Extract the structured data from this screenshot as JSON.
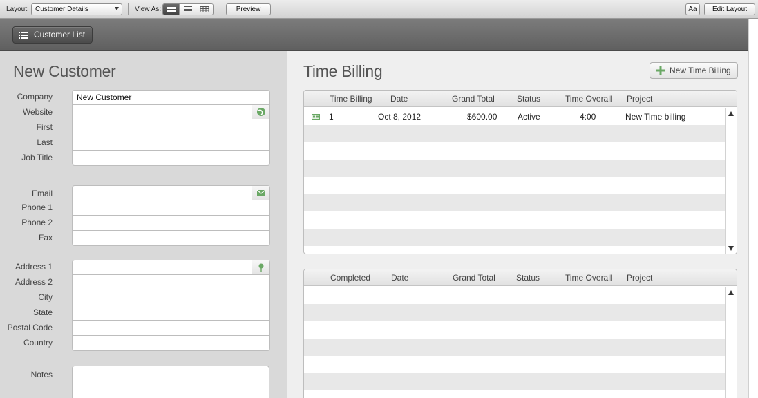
{
  "toolbar": {
    "layout_label": "Layout:",
    "layout_value": "Customer Details",
    "view_as_label": "View As:",
    "preview_label": "Preview",
    "font_button": "Aa",
    "edit_layout_label": "Edit Layout"
  },
  "header": {
    "customer_list_label": "Customer List"
  },
  "customer": {
    "title": "New Customer",
    "fields_group1": [
      {
        "label": "Company",
        "value": "New Customer"
      },
      {
        "label": "Website",
        "value": ""
      },
      {
        "label": "First",
        "value": ""
      },
      {
        "label": "Last",
        "value": ""
      },
      {
        "label": "Job Title",
        "value": ""
      }
    ],
    "fields_group2": [
      {
        "label": "Email",
        "value": ""
      },
      {
        "label": "Phone 1",
        "value": ""
      },
      {
        "label": "Phone 2",
        "value": ""
      },
      {
        "label": "Fax",
        "value": ""
      }
    ],
    "fields_group3": [
      {
        "label": "Address 1",
        "value": ""
      },
      {
        "label": "Address 2",
        "value": ""
      },
      {
        "label": "City",
        "value": ""
      },
      {
        "label": "State",
        "value": ""
      },
      {
        "label": "Postal Code",
        "value": ""
      },
      {
        "label": "Country",
        "value": ""
      }
    ],
    "notes_label": "Notes"
  },
  "time_billing": {
    "title": "Time Billing",
    "new_button": "New Time Billing",
    "columns": [
      "Time Billing",
      "Date",
      "Grand Total",
      "Status",
      "Time Overall",
      "Project"
    ],
    "rows": [
      {
        "id": "1",
        "date": "Oct 8, 2012",
        "grand_total": "$600.00",
        "status": "Active",
        "time_overall": "4:00",
        "project": "New Time billing"
      }
    ]
  },
  "completed": {
    "columns": [
      "Completed",
      "Date",
      "Grand Total",
      "Status",
      "Time Overall",
      "Project"
    ]
  },
  "colors": {
    "accent_green": "#6aa865",
    "header_gray": "#6e6e6e"
  }
}
